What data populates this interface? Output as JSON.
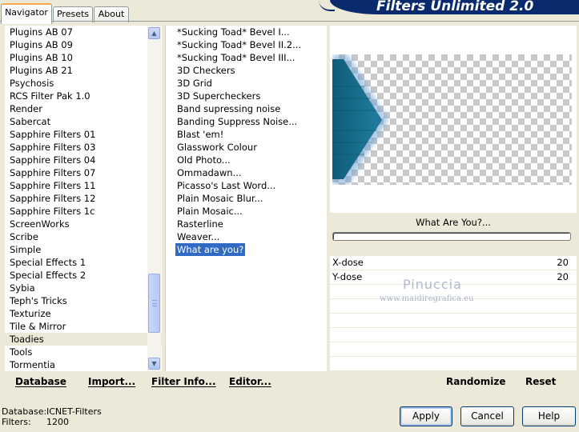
{
  "tabs": [
    {
      "label": "Navigator"
    },
    {
      "label": "Presets"
    },
    {
      "label": "About"
    }
  ],
  "banner": {
    "title": "Filters Unlimited 2.0"
  },
  "categories": [
    "Plugins AB 07",
    "Plugins AB 09",
    "Plugins AB 10",
    "Plugins AB 21",
    "Psychosis",
    "RCS Filter Pak 1.0",
    "Render",
    "Sabercat",
    "Sapphire Filters 01",
    "Sapphire Filters 03",
    "Sapphire Filters 04",
    "Sapphire Filters 07",
    "Sapphire Filters 11",
    "Sapphire Filters 12",
    "Sapphire Filters 1c",
    "ScreenWorks",
    "Scribe",
    "Simple",
    "Special Effects 1",
    "Special Effects 2",
    "Sybia",
    "Teph's Tricks",
    "Texturize",
    "Tile & Mirror",
    "Toadies",
    "Tools",
    "Tormentia"
  ],
  "selected_category": "Toadies",
  "filters": [
    "*Sucking Toad*  Bevel I...",
    "*Sucking Toad*  Bevel II.2...",
    "*Sucking Toad*  Bevel III...",
    "3D Checkers",
    "3D Grid",
    "3D Supercheckers",
    "Band supressing noise",
    "Banding Suppress Noise...",
    "Blast 'em!",
    "Glasswork Colour",
    "Old Photo...",
    "Ommadawn...",
    "Picasso's Last Word...",
    "Plain Mosaic Blur...",
    "Plain Mosaic...",
    "Rasterline",
    "Weaver...",
    "What are you?"
  ],
  "selected_filter": "What are you?",
  "preview": {
    "filter_title": "What Are You?...",
    "progress": 0
  },
  "params": [
    {
      "name": "X-dose",
      "value": "20"
    },
    {
      "name": "Y-dose",
      "value": "20"
    }
  ],
  "watermark": {
    "line1": "Pinuccia",
    "line2": "www.maidiregrafica.eu"
  },
  "toolbar": {
    "database": "Database",
    "import": "Import...",
    "filter_info": "Filter Info...",
    "editor": "Editor...",
    "randomize": "Randomize",
    "reset": "Reset"
  },
  "status": {
    "database_label": "Database:",
    "database_value": "ICNET-Filters",
    "filters_label": "Filters:",
    "filters_value": "1200"
  },
  "buttons": {
    "apply": "Apply",
    "cancel": "Cancel",
    "help": "Help"
  },
  "colors": {
    "selection": "#316ac5",
    "banner": "#0a2a6e",
    "window_bg": "#ece9d8",
    "preview_shape": "#1f6f8b"
  }
}
